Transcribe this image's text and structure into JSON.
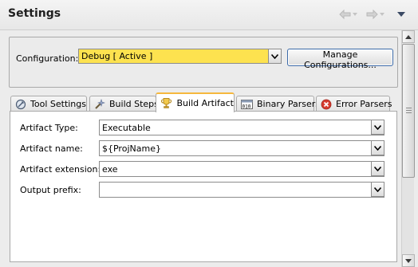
{
  "header": {
    "title": "Settings"
  },
  "config": {
    "label": "Configuration:",
    "selected": "Debug  [ Active ]",
    "manage_label": "Manage Configurations..."
  },
  "tabs": [
    {
      "label": "Tool Settings",
      "icon": "wrench-settings-icon",
      "active": false
    },
    {
      "label": "Build Steps",
      "icon": "build-wand-icon",
      "active": false
    },
    {
      "label": "Build Artifact",
      "icon": "trophy-icon",
      "active": true
    },
    {
      "label": "Binary Parsers",
      "icon": "binary-icon",
      "active": false
    },
    {
      "label": "Error Parsers",
      "icon": "error-icon",
      "active": false
    }
  ],
  "artifact": {
    "type_label": "Artifact Type:",
    "type_value": "Executable",
    "name_label": "Artifact name:",
    "name_value": "${ProjName}",
    "ext_label": "Artifact extension:",
    "ext_value": "exe",
    "prefix_label": "Output prefix:",
    "prefix_value": ""
  },
  "colors": {
    "config_highlight": "#fde24f",
    "active_tab_accent": "#f5b73d",
    "error_red": "#d63b2f"
  }
}
